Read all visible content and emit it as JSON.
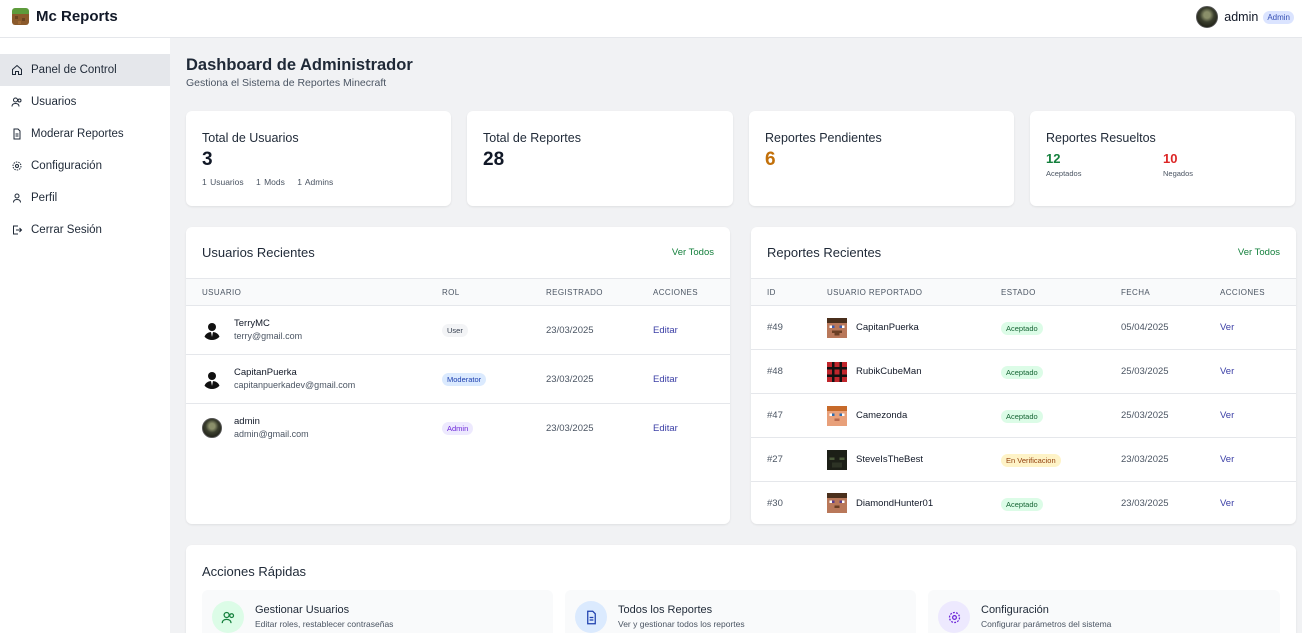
{
  "app": {
    "name": "Mc Reports"
  },
  "header": {
    "user_name": "admin",
    "user_badge": "Admin"
  },
  "sidebar": {
    "items": [
      {
        "label": "Panel de Control",
        "icon": "home-icon",
        "active": true
      },
      {
        "label": "Usuarios",
        "icon": "users-icon"
      },
      {
        "label": "Moderar Reportes",
        "icon": "document-icon"
      },
      {
        "label": "Configuración",
        "icon": "gear-icon"
      },
      {
        "label": "Perfil",
        "icon": "user-icon"
      },
      {
        "label": "Cerrar Sesión",
        "icon": "logout-icon"
      }
    ]
  },
  "page": {
    "title": "Dashboard de Administrador",
    "subtitle": "Gestiona el Sistema de Reportes Minecraft"
  },
  "stats": {
    "users": {
      "title": "Total de Usuarios",
      "value": "3",
      "detail_users": "1 Usuarios",
      "detail_mods": "1 Mods",
      "detail_admins": "1 Admins"
    },
    "reports": {
      "title": "Total de Reportes",
      "value": "28"
    },
    "pending": {
      "title": "Reportes Pendientes",
      "value": "6",
      "color": "#c2700a"
    },
    "resolved": {
      "title": "Reportes Resueltos",
      "accepted_value": "12",
      "accepted_label": "Aceptados",
      "accepted_color": "#15803d",
      "denied_value": "10",
      "denied_label": "Negados",
      "denied_color": "#dc2626"
    }
  },
  "recent_users": {
    "title": "Usuarios Recientes",
    "view_all": "Ver Todos",
    "columns": [
      "USUARIO",
      "ROL",
      "REGISTRADO",
      "ACCIONES"
    ],
    "rows": [
      {
        "name": "TerryMC",
        "email": "terry@gmail.com",
        "role": "User",
        "date": "23/03/2025",
        "action": "Editar"
      },
      {
        "name": "CapitanPuerka",
        "email": "capitanpuerkadev@gmail.com",
        "role": "Moderator",
        "date": "23/03/2025",
        "action": "Editar"
      },
      {
        "name": "admin",
        "email": "admin@gmail.com",
        "role": "Admin",
        "date": "23/03/2025",
        "action": "Editar"
      }
    ]
  },
  "recent_reports": {
    "title": "Reportes Recientes",
    "view_all": "Ver Todos",
    "columns": [
      "ID",
      "USUARIO REPORTADO",
      "ESTADO",
      "FECHA",
      "ACCIONES"
    ],
    "rows": [
      {
        "id": "#49",
        "user": "CapitanPuerka",
        "status": "Aceptado",
        "date": "05/04/2025",
        "action": "Ver"
      },
      {
        "id": "#48",
        "user": "RubikCubeMan",
        "status": "Aceptado",
        "date": "25/03/2025",
        "action": "Ver"
      },
      {
        "id": "#47",
        "user": "Camezonda",
        "status": "Aceptado",
        "date": "25/03/2025",
        "action": "Ver"
      },
      {
        "id": "#27",
        "user": "SteveIsTheBest",
        "status": "En Verificacion",
        "date": "23/03/2025",
        "action": "Ver"
      },
      {
        "id": "#30",
        "user": "DiamondHunter01",
        "status": "Aceptado",
        "date": "23/03/2025",
        "action": "Ver"
      }
    ]
  },
  "quick_actions": {
    "title": "Acciones Rápidas",
    "items": [
      {
        "title": "Gestionar Usuarios",
        "subtitle": "Editar roles, restablecer contraseñas",
        "icon": "users-icon"
      },
      {
        "title": "Todos los Reportes",
        "subtitle": "Ver y gestionar todos los reportes",
        "icon": "document-icon"
      },
      {
        "title": "Configuración",
        "subtitle": "Configurar parámetros del sistema",
        "icon": "gear-icon"
      }
    ]
  }
}
